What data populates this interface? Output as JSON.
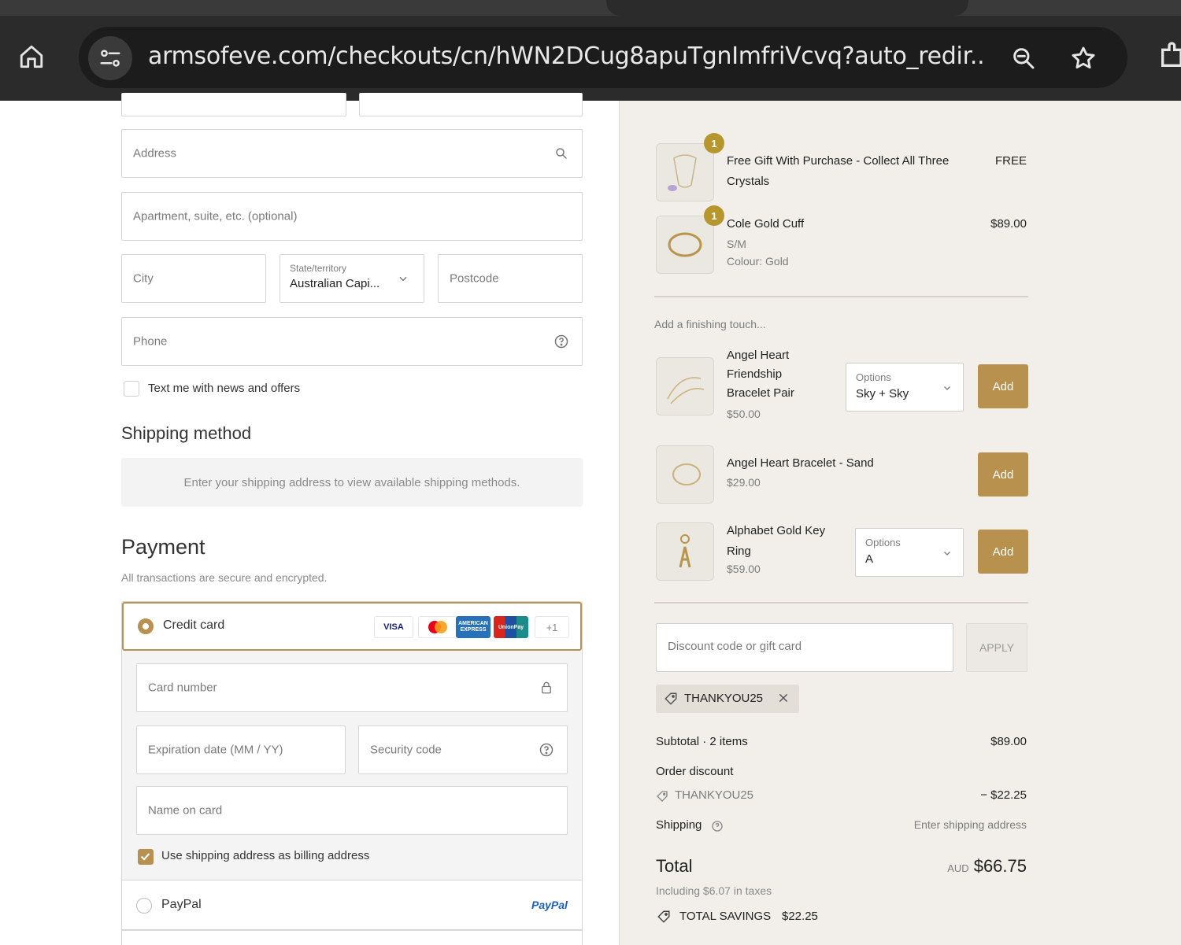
{
  "browser": {
    "url": "armsofeve.com/checkouts/cn/hWN2DCug8apuTgnImfriVcvq?auto_redir..."
  },
  "address_form": {
    "address_placeholder": "Address",
    "apartment_placeholder": "Apartment, suite, etc. (optional)",
    "city_placeholder": "City",
    "state_label": "State/territory",
    "state_value": "Australian Capi...",
    "postcode_placeholder": "Postcode",
    "phone_placeholder": "Phone",
    "sms_optin_label": "Text me with news and offers"
  },
  "shipping_method": {
    "heading": "Shipping method",
    "notice": "Enter your shipping address to view available shipping methods."
  },
  "payment": {
    "heading": "Payment",
    "subtext": "All transactions are secure and encrypted.",
    "credit_card_label": "Credit card",
    "card_logos": [
      "VISA",
      "Mastercard",
      "AMEX",
      "UnionPay",
      "+1"
    ],
    "more_cards": "+1",
    "visa_text": "VISA",
    "amex_text": "AMERICAN EXPRESS",
    "unionpay_text": "UnionPay",
    "card_number_placeholder": "Card number",
    "expiry_placeholder": "Expiration date (MM / YY)",
    "security_code_placeholder": "Security code",
    "name_on_card_placeholder": "Name on card",
    "billing_same_label": "Use shipping address as billing address",
    "billing_same_checked": true,
    "paypal_label": "PayPal",
    "paypal_logo": "PayPal"
  },
  "cart_items": [
    {
      "quantity": "1",
      "name_line1": "Free Gift With Purchase - Collect All Three",
      "name_line2": "Crystals",
      "price": "FREE"
    },
    {
      "quantity": "1",
      "name": "Cole Gold Cuff",
      "variant": "S/M",
      "colour": "Colour: Gold",
      "price": "$89.00"
    }
  ],
  "upsell": {
    "heading": "Add a finishing touch...",
    "items": [
      {
        "name_lines": [
          "Angel Heart",
          "Friendship",
          "Bracelet Pair"
        ],
        "price": "$50.00",
        "options_label": "Options",
        "options_value": "Sky + Sky",
        "add_label": "Add"
      },
      {
        "name": "Angel Heart Bracelet - Sand",
        "price": "$29.00",
        "add_label": "Add"
      },
      {
        "name_lines": [
          "Alphabet Gold Key",
          "Ring"
        ],
        "price": "$59.00",
        "options_label": "Options",
        "options_value": "A",
        "add_label": "Add"
      }
    ]
  },
  "discount": {
    "placeholder": "Discount code or gift card",
    "apply_label": "APPLY",
    "applied_code": "THANKYOU25"
  },
  "summary": {
    "subtotal_label": "Subtotal · 2 items",
    "subtotal_value": "$89.00",
    "order_discount_label": "Order discount",
    "discount_code": "THANKYOU25",
    "discount_value": "− $22.25",
    "shipping_label": "Shipping",
    "shipping_value": "Enter shipping address",
    "total_label": "Total",
    "currency": "AUD",
    "total_value": "$66.75",
    "taxes_note": "Including $6.07 in taxes",
    "savings_label": "TOTAL SAVINGS",
    "savings_value": "$22.25"
  },
  "colors": {
    "accent_gold": "#b89150",
    "qty_badge": "#b8962e",
    "summary_bg": "#f2efea",
    "chrome_bg": "#2b2b2b"
  }
}
